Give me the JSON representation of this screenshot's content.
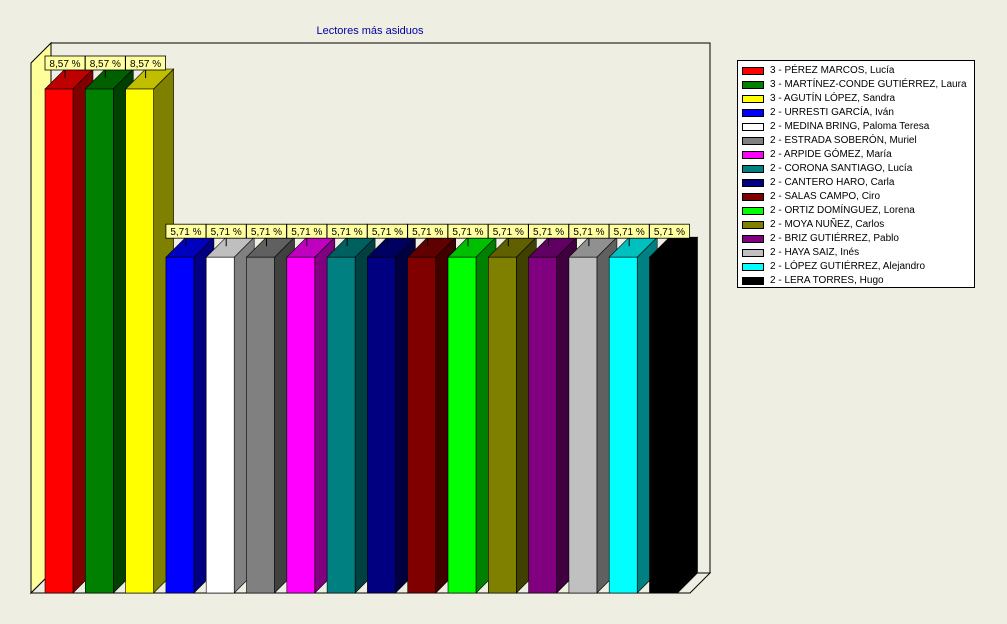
{
  "chart_data": {
    "type": "bar",
    "title": "Lectores más asiduos",
    "legend_position": "right",
    "ylim": [
      0,
      9.6
    ],
    "categories": [
      "3  - PÉREZ MARCOS, Lucía",
      "3  - MARTÍNEZ-CONDE GUTIÉRREZ, Laura",
      "3  - AGUTÍN LÓPEZ, Sandra",
      "2  - URRESTI GARCÍA, Iván",
      "2  - MEDINA BRING, Paloma Teresa",
      "2  - ESTRADA SOBERÓN, Muriel",
      "2  - ARPIDE GÓMEZ, María",
      "2  - CORONA SANTIAGO, Lucía",
      "2  - CANTERO HARO, Carla",
      "2  - SALAS CAMPO, Ciro",
      "2  - ORTIZ DOMÍNGUEZ, Lorena",
      "2  - MOYA NUÑEZ, Carlos",
      "2  - BRIZ GUTIÉRREZ, Pablo",
      "2  - HAYA SAIZ, Inés",
      "2  - LÓPEZ GUTIÉRREZ, Alejandro",
      "2  - LERA TORRES, Hugo"
    ],
    "values": [
      8.57,
      8.57,
      8.57,
      5.71,
      5.71,
      5.71,
      5.71,
      5.71,
      5.71,
      5.71,
      5.71,
      5.71,
      5.71,
      5.71,
      5.71,
      5.71
    ],
    "data_labels": [
      "8,57 %",
      "8,57 %",
      "8,57 %",
      "5,71 %",
      "5,71 %",
      "5,71 %",
      "5,71 %",
      "5,71 %",
      "5,71 %",
      "5,71 %",
      "5,71 %",
      "5,71 %",
      "5,71 %",
      "5,71 %",
      "5,71 %",
      "5,71 %"
    ],
    "colors": [
      "#FF0000",
      "#008000",
      "#FFFF00",
      "#0000FF",
      "#FFFFFF",
      "#808080",
      "#FF00FF",
      "#008080",
      "#000080",
      "#800000",
      "#00FF00",
      "#808000",
      "#800080",
      "#C0C0C0",
      "#00FFFF",
      "#000000"
    ]
  }
}
